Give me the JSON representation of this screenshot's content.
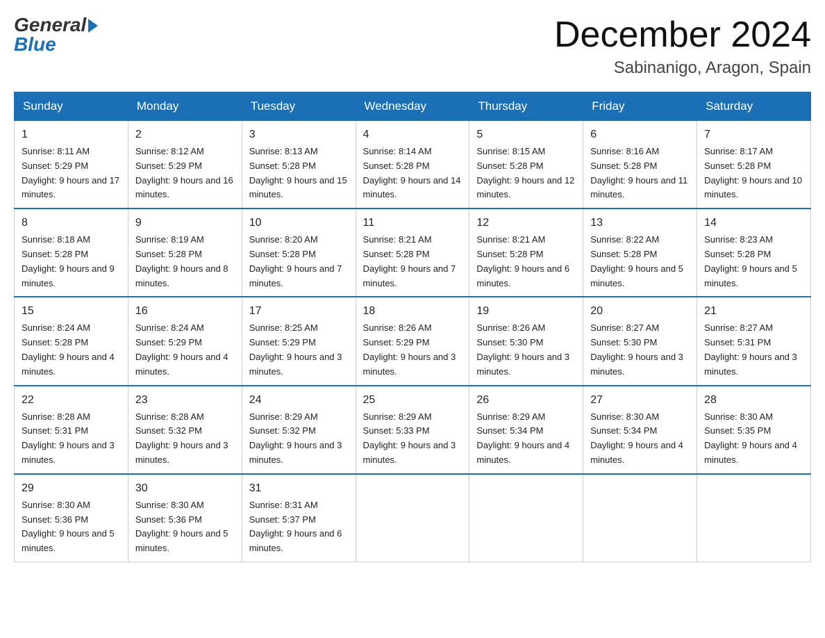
{
  "header": {
    "logo": {
      "general": "General",
      "blue": "Blue"
    },
    "title": "December 2024",
    "location": "Sabinanigo, Aragon, Spain"
  },
  "columns": [
    "Sunday",
    "Monday",
    "Tuesday",
    "Wednesday",
    "Thursday",
    "Friday",
    "Saturday"
  ],
  "weeks": [
    [
      {
        "day": "1",
        "sunrise": "8:11 AM",
        "sunset": "5:29 PM",
        "daylight": "9 hours and 17 minutes."
      },
      {
        "day": "2",
        "sunrise": "8:12 AM",
        "sunset": "5:29 PM",
        "daylight": "9 hours and 16 minutes."
      },
      {
        "day": "3",
        "sunrise": "8:13 AM",
        "sunset": "5:28 PM",
        "daylight": "9 hours and 15 minutes."
      },
      {
        "day": "4",
        "sunrise": "8:14 AM",
        "sunset": "5:28 PM",
        "daylight": "9 hours and 14 minutes."
      },
      {
        "day": "5",
        "sunrise": "8:15 AM",
        "sunset": "5:28 PM",
        "daylight": "9 hours and 12 minutes."
      },
      {
        "day": "6",
        "sunrise": "8:16 AM",
        "sunset": "5:28 PM",
        "daylight": "9 hours and 11 minutes."
      },
      {
        "day": "7",
        "sunrise": "8:17 AM",
        "sunset": "5:28 PM",
        "daylight": "9 hours and 10 minutes."
      }
    ],
    [
      {
        "day": "8",
        "sunrise": "8:18 AM",
        "sunset": "5:28 PM",
        "daylight": "9 hours and 9 minutes."
      },
      {
        "day": "9",
        "sunrise": "8:19 AM",
        "sunset": "5:28 PM",
        "daylight": "9 hours and 8 minutes."
      },
      {
        "day": "10",
        "sunrise": "8:20 AM",
        "sunset": "5:28 PM",
        "daylight": "9 hours and 7 minutes."
      },
      {
        "day": "11",
        "sunrise": "8:21 AM",
        "sunset": "5:28 PM",
        "daylight": "9 hours and 7 minutes."
      },
      {
        "day": "12",
        "sunrise": "8:21 AM",
        "sunset": "5:28 PM",
        "daylight": "9 hours and 6 minutes."
      },
      {
        "day": "13",
        "sunrise": "8:22 AM",
        "sunset": "5:28 PM",
        "daylight": "9 hours and 5 minutes."
      },
      {
        "day": "14",
        "sunrise": "8:23 AM",
        "sunset": "5:28 PM",
        "daylight": "9 hours and 5 minutes."
      }
    ],
    [
      {
        "day": "15",
        "sunrise": "8:24 AM",
        "sunset": "5:28 PM",
        "daylight": "9 hours and 4 minutes."
      },
      {
        "day": "16",
        "sunrise": "8:24 AM",
        "sunset": "5:29 PM",
        "daylight": "9 hours and 4 minutes."
      },
      {
        "day": "17",
        "sunrise": "8:25 AM",
        "sunset": "5:29 PM",
        "daylight": "9 hours and 3 minutes."
      },
      {
        "day": "18",
        "sunrise": "8:26 AM",
        "sunset": "5:29 PM",
        "daylight": "9 hours and 3 minutes."
      },
      {
        "day": "19",
        "sunrise": "8:26 AM",
        "sunset": "5:30 PM",
        "daylight": "9 hours and 3 minutes."
      },
      {
        "day": "20",
        "sunrise": "8:27 AM",
        "sunset": "5:30 PM",
        "daylight": "9 hours and 3 minutes."
      },
      {
        "day": "21",
        "sunrise": "8:27 AM",
        "sunset": "5:31 PM",
        "daylight": "9 hours and 3 minutes."
      }
    ],
    [
      {
        "day": "22",
        "sunrise": "8:28 AM",
        "sunset": "5:31 PM",
        "daylight": "9 hours and 3 minutes."
      },
      {
        "day": "23",
        "sunrise": "8:28 AM",
        "sunset": "5:32 PM",
        "daylight": "9 hours and 3 minutes."
      },
      {
        "day": "24",
        "sunrise": "8:29 AM",
        "sunset": "5:32 PM",
        "daylight": "9 hours and 3 minutes."
      },
      {
        "day": "25",
        "sunrise": "8:29 AM",
        "sunset": "5:33 PM",
        "daylight": "9 hours and 3 minutes."
      },
      {
        "day": "26",
        "sunrise": "8:29 AM",
        "sunset": "5:34 PM",
        "daylight": "9 hours and 4 minutes."
      },
      {
        "day": "27",
        "sunrise": "8:30 AM",
        "sunset": "5:34 PM",
        "daylight": "9 hours and 4 minutes."
      },
      {
        "day": "28",
        "sunrise": "8:30 AM",
        "sunset": "5:35 PM",
        "daylight": "9 hours and 4 minutes."
      }
    ],
    [
      {
        "day": "29",
        "sunrise": "8:30 AM",
        "sunset": "5:36 PM",
        "daylight": "9 hours and 5 minutes."
      },
      {
        "day": "30",
        "sunrise": "8:30 AM",
        "sunset": "5:36 PM",
        "daylight": "9 hours and 5 minutes."
      },
      {
        "day": "31",
        "sunrise": "8:31 AM",
        "sunset": "5:37 PM",
        "daylight": "9 hours and 6 minutes."
      },
      null,
      null,
      null,
      null
    ]
  ]
}
